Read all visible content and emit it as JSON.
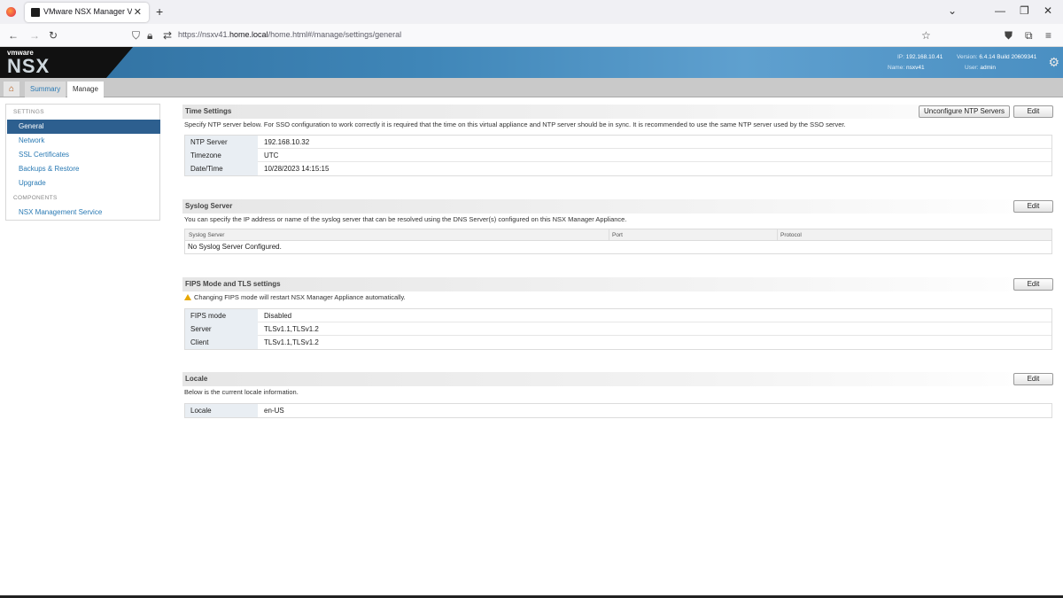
{
  "browser": {
    "tab_title": "VMware NSX Manager Virtual A",
    "url_prefix": "https://nsxv41.",
    "url_host": "home.local",
    "url_path": "/home.html#/manage/settings/general"
  },
  "header": {
    "brand_small": "vmware",
    "brand": "NSX",
    "ip_label": "IP:",
    "ip": "192.168.10.41",
    "name_label": "Name:",
    "name": "nsxv41",
    "version_label": "Version:",
    "version": "6.4.14 Build 20609341",
    "user_label": "User:",
    "user": "admin"
  },
  "tabs": {
    "summary": "Summary",
    "manage": "Manage"
  },
  "sidebar": {
    "settings_heading": "SETTINGS",
    "items": [
      "General",
      "Network",
      "SSL Certificates",
      "Backups & Restore",
      "Upgrade"
    ],
    "components_heading": "COMPONENTS",
    "components": [
      "NSX Management Service"
    ]
  },
  "time_settings": {
    "title": "Time Settings",
    "unconfigure_label": "Unconfigure NTP Servers",
    "edit_label": "Edit",
    "description": "Specify NTP server below. For SSO configuration to work correctly it is required that the time on this virtual appliance and NTP server should be in sync. It is recommended to use the same NTP server used by the SSO server.",
    "rows": [
      {
        "key": "NTP Server",
        "value": "192.168.10.32"
      },
      {
        "key": "Timezone",
        "value": "UTC"
      },
      {
        "key": "Date/Time",
        "value": "10/28/2023 14:15:15"
      }
    ]
  },
  "syslog": {
    "title": "Syslog Server",
    "edit_label": "Edit",
    "description": "You can specify the IP address or name of the syslog server that can be resolved using the DNS Server(s) configured on this NSX Manager Appliance.",
    "columns": [
      "Syslog Server",
      "Port",
      "Protocol"
    ],
    "empty": "No Syslog Server Configured."
  },
  "fips": {
    "title": "FIPS Mode and TLS settings",
    "edit_label": "Edit",
    "warning": "Changing FIPS mode will restart NSX Manager Appliance automatically.",
    "rows": [
      {
        "key": "FIPS mode",
        "value": "Disabled"
      },
      {
        "key": "Server",
        "value": "TLSv1.1,TLSv1.2"
      },
      {
        "key": "Client",
        "value": "TLSv1.1,TLSv1.2"
      }
    ]
  },
  "locale": {
    "title": "Locale",
    "edit_label": "Edit",
    "description": "Below is the current locale information.",
    "rows": [
      {
        "key": "Locale",
        "value": "en-US"
      }
    ]
  }
}
